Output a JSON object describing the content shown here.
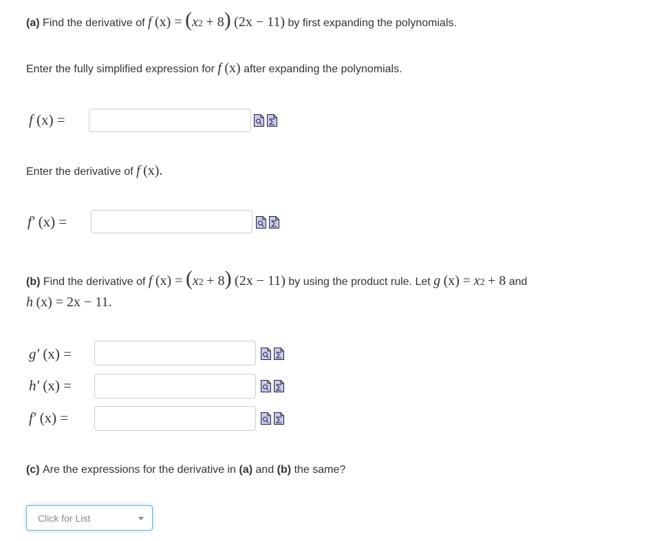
{
  "part_a": {
    "label": "(a)",
    "prompt_pre": "Find the derivative of",
    "function_lhs": "f",
    "function_arg": "(x) =",
    "factor1_open": "(",
    "factor1_base": "x",
    "factor1_exp": "2",
    "factor1_rest": "+ 8",
    "factor1_close": ")",
    "factor2": "(2x − 11)",
    "prompt_post": "by first expanding the polynomials.",
    "instruction1_pre": "Enter the fully simplified expression for",
    "instruction1_fn": "f",
    "instruction1_arg": "(x)",
    "instruction1_post": "after expanding the polynomials.",
    "answer1": {
      "label_fn": "f",
      "label_rest": "(x) =",
      "value": ""
    },
    "instruction2_pre": "Enter the derivative of",
    "instruction2_fn": "f",
    "instruction2_arg": "(x).",
    "answer2": {
      "label_fn": "f′",
      "label_rest": "(x) =",
      "value": ""
    }
  },
  "part_b": {
    "label": "(b)",
    "prompt_pre": "Find the derivative of",
    "function_lhs": "f",
    "function_arg": "(x) =",
    "factor1_open": "(",
    "factor1_base": "x",
    "factor1_exp": "2",
    "factor1_rest": "+ 8",
    "factor1_close": ")",
    "factor2": "(2x − 11)",
    "prompt_mid": "by using the product rule. Let",
    "g_def_fn": "g",
    "g_def_arg": "(x) =",
    "g_def_base": "x",
    "g_def_exp": "2",
    "g_def_rest": "+ 8",
    "and": "and",
    "h_def_fn": "h",
    "h_def_rest": "(x) = 2x − 11.",
    "answers": [
      {
        "label_fn": "g′",
        "label_rest": "(x) =",
        "value": ""
      },
      {
        "label_fn": "h′",
        "label_rest": "(x) =",
        "value": ""
      },
      {
        "label_fn": "f′",
        "label_rest": "(x) =",
        "value": ""
      }
    ]
  },
  "part_c": {
    "label": "(c)",
    "prompt_pre": "Are the expressions for the derivative in",
    "ref_a": "(a)",
    "and": "and",
    "ref_b": "(b)",
    "prompt_post": "the same?",
    "dropdown": {
      "placeholder": "Click for List",
      "selected": ""
    }
  },
  "icons": {
    "preview": "preview-magnifier-icon",
    "equation_editor": "sigma-equation-icon",
    "fill_color": "#c8c8f5"
  }
}
